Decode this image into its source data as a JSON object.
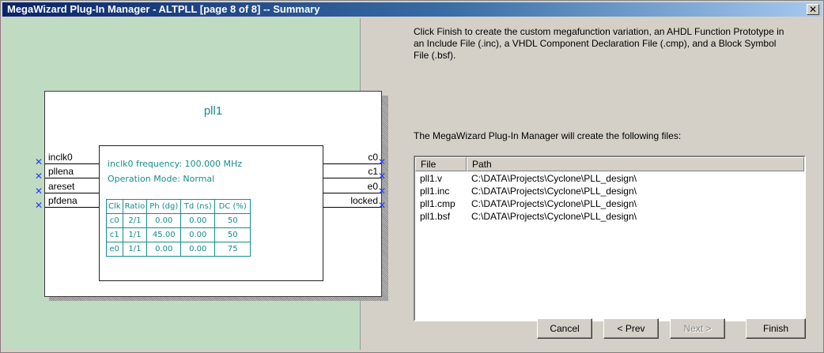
{
  "window": {
    "title": "MegaWizard Plug-In Manager - ALTPLL [page 8 of 8] -- Summary",
    "close_glyph": "✕"
  },
  "symbol": {
    "name": "pll1",
    "freq_text": "inclk0 frequency: 100.000 MHz",
    "mode_text": "Operation Mode: Normal",
    "inputs": [
      "inclk0",
      "pllena",
      "areset",
      "pfdena"
    ],
    "outputs": [
      "c0",
      "c1",
      "e0",
      "locked"
    ],
    "pin_marker": "✕",
    "table": {
      "headers": [
        "Clk",
        "Ratio",
        "Ph (dg)",
        "Td (ns)",
        "DC (%)"
      ],
      "rows": [
        [
          "c0",
          "2/1",
          "0.00",
          "0.00",
          "50"
        ],
        [
          "c1",
          "1/1",
          "45.00",
          "0.00",
          "50"
        ],
        [
          "e0",
          "1/1",
          "0.00",
          "0.00",
          "75"
        ]
      ]
    }
  },
  "summary": {
    "description": "Click Finish to create the custom megafunction variation, an AHDL Function Prototype in an Include File (.inc), a VHDL Component Declaration File (.cmp), and a Block Symbol File (.bsf).",
    "files_label": "The MegaWizard Plug-In Manager will create the following files:",
    "columns": [
      "File",
      "Path"
    ],
    "files": [
      {
        "file": "pll1.v",
        "path": "C:\\DATA\\Projects\\Cyclone\\PLL_design\\"
      },
      {
        "file": "pll1.inc",
        "path": "C:\\DATA\\Projects\\Cyclone\\PLL_design\\"
      },
      {
        "file": "pll1.cmp",
        "path": "C:\\DATA\\Projects\\Cyclone\\PLL_design\\"
      },
      {
        "file": "pll1.bsf",
        "path": "C:\\DATA\\Projects\\Cyclone\\PLL_design\\"
      }
    ]
  },
  "buttons": {
    "cancel": "Cancel",
    "prev": "< Prev",
    "next": "Next >",
    "finish": "Finish"
  }
}
